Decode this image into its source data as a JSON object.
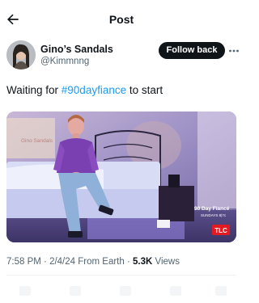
{
  "header": {
    "title": "Post",
    "back_icon": "arrow-left-icon"
  },
  "author": {
    "display_name": "Gino’s Sandals",
    "handle": "@Kimmnng",
    "follow_label": "Follow back",
    "more_icon": "more-horizontal-icon"
  },
  "tweet": {
    "text_before": "Waiting for ",
    "hashtag": "#90dayfiance",
    "text_after": " to start"
  },
  "media": {
    "overlay_text_top": "Gino Sandals",
    "show_text": "90 Day Fiancé",
    "schedule_text": "SUNDAYS 8|7c",
    "network_logo": "TLC",
    "colors": {
      "wall": "#9b8fc4",
      "bed": "#d8dcf5",
      "shirt": "#7a3fb0",
      "jeans": "#8fb0d8",
      "logo": "#e21b23"
    }
  },
  "meta": {
    "time": "7:58 PM",
    "date": "2/4/24",
    "source": "From Earth",
    "views_count": "5.3K",
    "views_label": "Views"
  }
}
